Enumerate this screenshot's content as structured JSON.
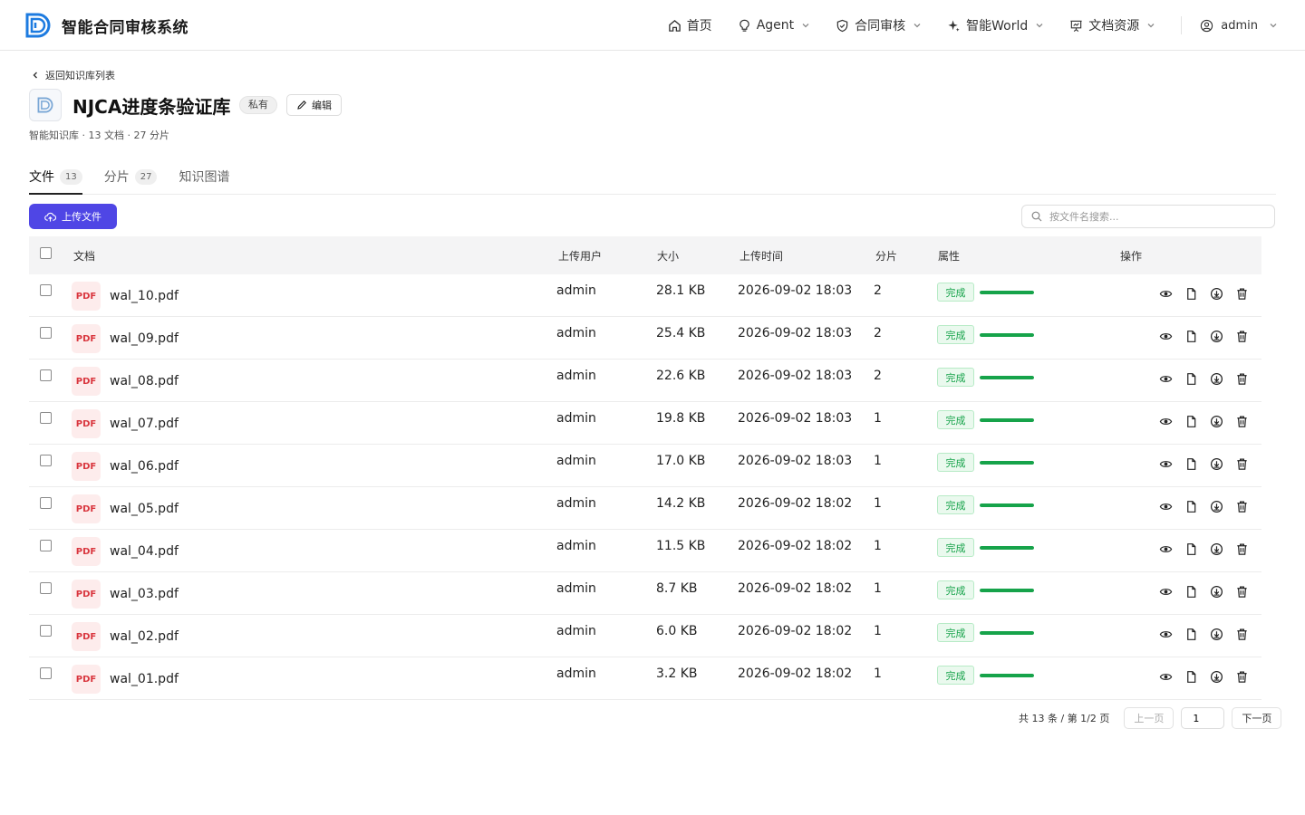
{
  "header": {
    "brand": "智能合同审核系统",
    "nav": [
      {
        "label": "首页",
        "icon": "home-icon",
        "has_dropdown": false
      },
      {
        "label": "Agent",
        "icon": "lightbulb-icon",
        "has_dropdown": true
      },
      {
        "label": "合同审核",
        "icon": "shield-check-icon",
        "has_dropdown": true
      },
      {
        "label": "智能World",
        "icon": "sparkle-icon",
        "has_dropdown": true
      },
      {
        "label": "文档资源",
        "icon": "presentation-icon",
        "has_dropdown": true
      }
    ],
    "user": "admin"
  },
  "back_label": "返回知识库列表",
  "kb": {
    "title": "NJCA进度条验证库",
    "visibility": "私有",
    "edit_label": "编辑",
    "meta": "智能知识库 · 13 文档 · 27 分片"
  },
  "tabs": [
    {
      "label": "文件",
      "count": "13",
      "active": true
    },
    {
      "label": "分片",
      "count": "27",
      "active": false
    },
    {
      "label": "知识图谱",
      "count": "",
      "active": false
    }
  ],
  "toolbar": {
    "upload_label": "上传文件",
    "search_placeholder": "按文件名搜索..."
  },
  "table": {
    "columns": {
      "doc": "文档",
      "user": "上传用户",
      "size": "大小",
      "time": "上传时间",
      "chunks": "分片",
      "attr": "属性",
      "ops": "操作"
    },
    "file_type_label": "PDF",
    "status_color": "#16a34a",
    "rows": [
      {
        "name": "wal_10.pdf",
        "user": "admin",
        "size": "28.1 KB",
        "time": "2026-09-02 18:03",
        "chunks": "2",
        "status": "完成",
        "progress": 1.0
      },
      {
        "name": "wal_09.pdf",
        "user": "admin",
        "size": "25.4 KB",
        "time": "2026-09-02 18:03",
        "chunks": "2",
        "status": "完成",
        "progress": 1.0
      },
      {
        "name": "wal_08.pdf",
        "user": "admin",
        "size": "22.6 KB",
        "time": "2026-09-02 18:03",
        "chunks": "2",
        "status": "完成",
        "progress": 1.0
      },
      {
        "name": "wal_07.pdf",
        "user": "admin",
        "size": "19.8 KB",
        "time": "2026-09-02 18:03",
        "chunks": "1",
        "status": "完成",
        "progress": 1.0
      },
      {
        "name": "wal_06.pdf",
        "user": "admin",
        "size": "17.0 KB",
        "time": "2026-09-02 18:03",
        "chunks": "1",
        "status": "完成",
        "progress": 1.0
      },
      {
        "name": "wal_05.pdf",
        "user": "admin",
        "size": "14.2 KB",
        "time": "2026-09-02 18:02",
        "chunks": "1",
        "status": "完成",
        "progress": 1.0
      },
      {
        "name": "wal_04.pdf",
        "user": "admin",
        "size": "11.5 KB",
        "time": "2026-09-02 18:02",
        "chunks": "1",
        "status": "完成",
        "progress": 1.0
      },
      {
        "name": "wal_03.pdf",
        "user": "admin",
        "size": "8.7 KB",
        "time": "2026-09-02 18:02",
        "chunks": "1",
        "status": "完成",
        "progress": 1.0
      },
      {
        "name": "wal_02.pdf",
        "user": "admin",
        "size": "6.0 KB",
        "time": "2026-09-02 18:02",
        "chunks": "1",
        "status": "完成",
        "progress": 1.0
      },
      {
        "name": "wal_01.pdf",
        "user": "admin",
        "size": "3.2 KB",
        "time": "2026-09-02 18:02",
        "chunks": "1",
        "status": "完成",
        "progress": 1.0
      }
    ],
    "row_actions": [
      "eye-icon",
      "file-icon",
      "download-icon",
      "trash-icon"
    ]
  },
  "pagination": {
    "info": "共 13 条 / 第 1/2 页",
    "prev_label": "上一页",
    "page_value": "1",
    "next_label": "下一页"
  }
}
